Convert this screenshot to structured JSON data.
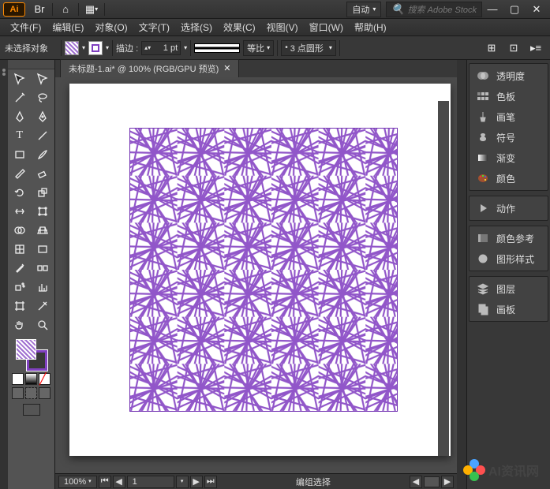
{
  "title": {
    "auto": "自动",
    "search_placeholder": "搜索 Adobe Stock"
  },
  "menus": {
    "file": "文件(F)",
    "edit": "编辑(E)",
    "object": "对象(O)",
    "type": "文字(T)",
    "select": "选择(S)",
    "effect": "效果(C)",
    "view": "视图(V)",
    "window": "窗口(W)",
    "help": "帮助(H)"
  },
  "opt": {
    "nosel": "未选择对象",
    "stroke_lbl": "描边 :",
    "stroke_val": "1 pt",
    "prop": "等比",
    "style_val": "3 点圆形"
  },
  "tab": {
    "label": "未标题-1.ai* @ 100% (RGB/GPU 预览)"
  },
  "status": {
    "zoom": "100%",
    "page": "1",
    "mode": "编组选择"
  },
  "panels": {
    "transparency": "透明度",
    "swatches": "色板",
    "brushes": "画笔",
    "symbols": "符号",
    "gradient": "渐变",
    "color": "颜色",
    "actions": "动作",
    "colorguide": "颜色参考",
    "graphicstyles": "图形样式",
    "layers": "图层",
    "artboards": "画板"
  },
  "watermark": "AI资讯网"
}
